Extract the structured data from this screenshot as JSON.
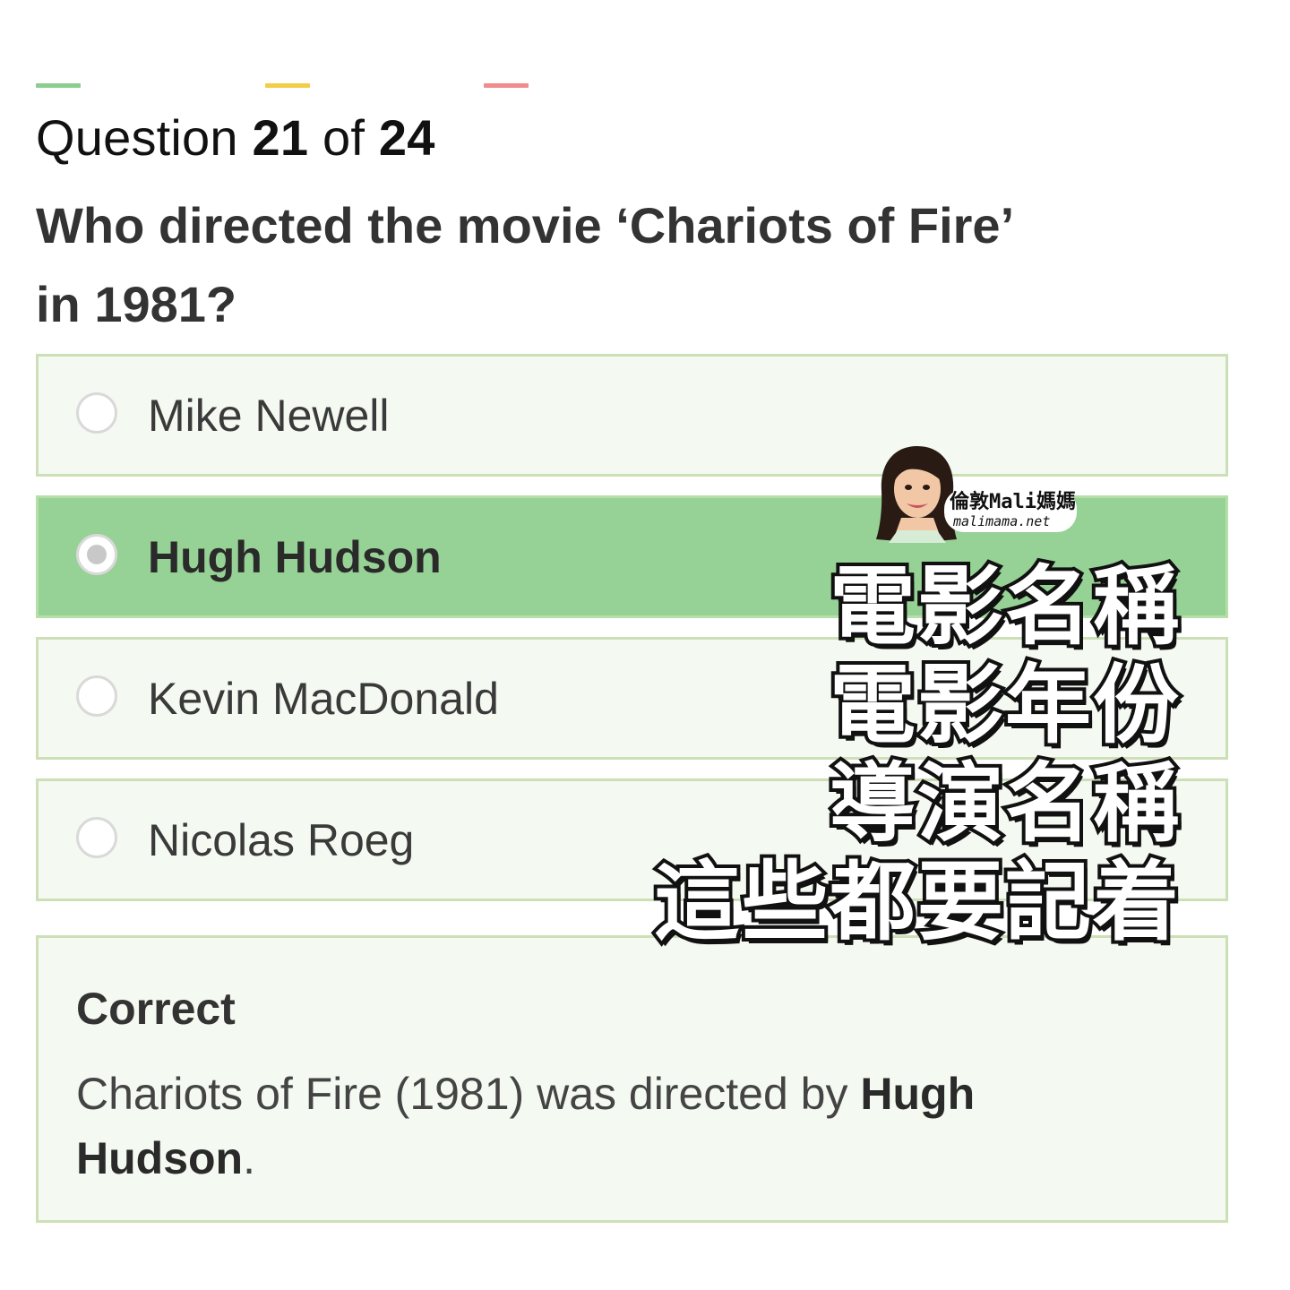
{
  "progress": {
    "marks": [
      {
        "color": "#8bcf8e"
      },
      {
        "color": "#f3cd45"
      },
      {
        "color": "#f08c8c"
      }
    ]
  },
  "header": {
    "question_prefix": "Question",
    "current": "21",
    "of_label": "of",
    "total": "24",
    "question_line1": "Who directed the movie ‘Chariots of Fire’",
    "question_line2": "in 1981?"
  },
  "options": [
    {
      "label": "Mike Newell",
      "selected": false
    },
    {
      "label": "Hugh Hudson",
      "selected": true
    },
    {
      "label": "Kevin MacDonald",
      "selected": false
    },
    {
      "label": "Nicolas Roeg",
      "selected": false
    }
  ],
  "feedback": {
    "title": "Correct",
    "text_prefix": "Chariots of Fire (1981) was directed by ",
    "answer": "Hugh Hudson",
    "text_suffix": "."
  },
  "watermark": {
    "name": "倫敦Mali媽媽",
    "site": "malimama.net"
  },
  "overlay": {
    "lines": [
      "電影名稱",
      "電影年份",
      "導演名稱",
      "這些都要記着"
    ]
  },
  "colors": {
    "option_bg": "#f4f9f1",
    "option_border": "#cddfb6",
    "selected_bg": "#96d195"
  }
}
